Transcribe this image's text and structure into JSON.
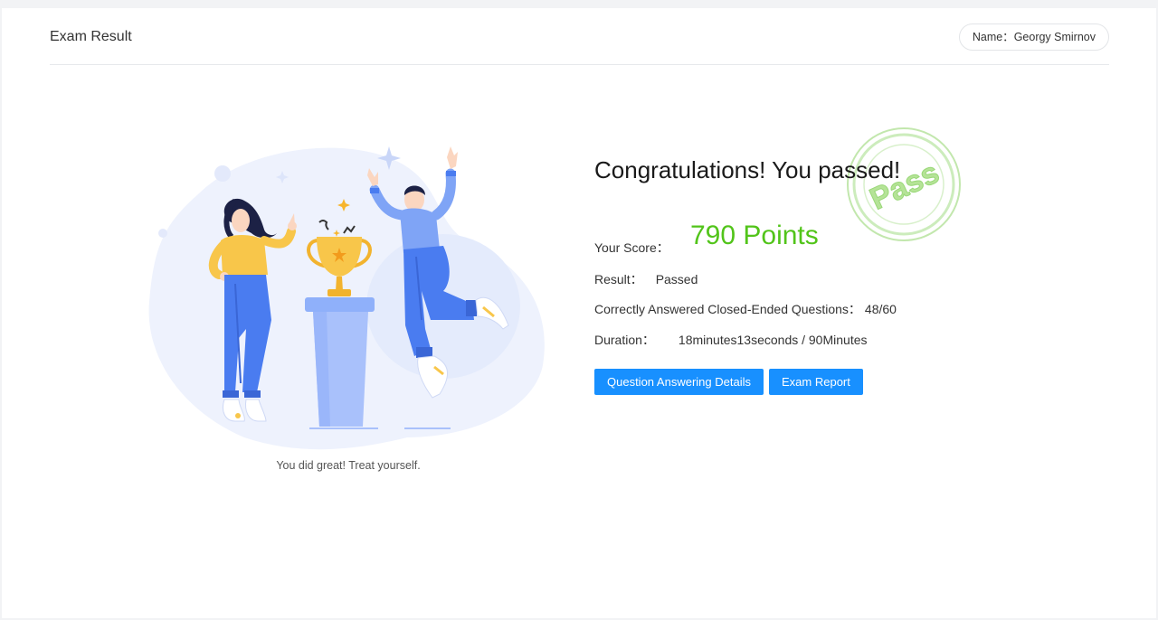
{
  "header": {
    "title": "Exam Result",
    "name_label": "Name：",
    "name_value": "Georgy Smirnov"
  },
  "illustration": {
    "caption": "You did great! Treat yourself."
  },
  "result": {
    "headline": "Congratulations! You passed!",
    "stamp_text": "Pass",
    "score_label": "Your Score：",
    "score_value": "790 Points",
    "result_label": "Result：",
    "result_value": "Passed",
    "correct_label": "Correctly Answered Closed-Ended Questions：",
    "correct_value": "48/60",
    "duration_label": "Duration：",
    "duration_value": "18minutes13seconds / 90Minutes"
  },
  "buttons": {
    "details_label": "Question Answering Details",
    "report_label": "Exam Report"
  },
  "colors": {
    "score": "#52c41a",
    "primary": "#1890ff",
    "stamp": "#8fd46a",
    "illustration_blue": "#4a7cf0",
    "illustration_yellow": "#f8c64a"
  },
  "icons": [
    "trophy-icon",
    "sparkle-icon"
  ]
}
